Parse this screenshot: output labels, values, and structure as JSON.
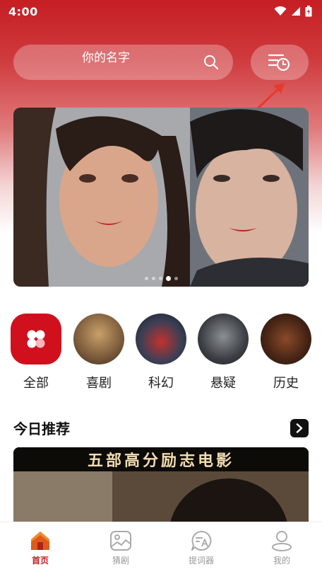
{
  "status_bar": {
    "time": "4:00"
  },
  "search": {
    "placeholder": "你的名字"
  },
  "banner": {
    "dots": 5,
    "active_dot": 3
  },
  "categories": [
    {
      "label": "全部",
      "icon": "grid-icon"
    },
    {
      "label": "喜剧"
    },
    {
      "label": "科幻"
    },
    {
      "label": "悬疑"
    },
    {
      "label": "历史"
    }
  ],
  "recommend": {
    "title": "今日推荐",
    "card_title": "五部高分励志电影"
  },
  "nav": [
    {
      "label": "首页",
      "icon": "home-icon",
      "active": true
    },
    {
      "label": "猜剧",
      "icon": "image-icon"
    },
    {
      "label": "提词器",
      "icon": "chat-a-icon"
    },
    {
      "label": "我的",
      "icon": "person-icon"
    }
  ],
  "colors": {
    "accent": "#c51e23",
    "nav_active": "#c02227"
  }
}
